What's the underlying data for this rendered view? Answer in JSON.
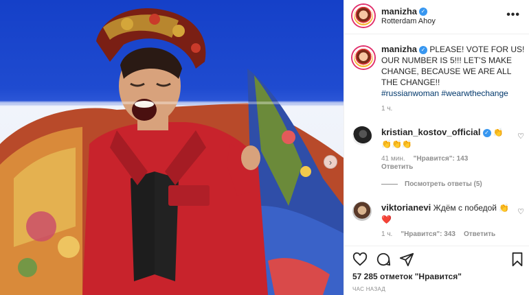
{
  "post": {
    "username": "manizha",
    "location": "Rotterdam Ahoy",
    "more_label": "•••"
  },
  "caption": {
    "username": "manizha",
    "text": "PLEASE! VOTE FOR US! OUR NUMBER IS 5!!! LET’S MAKE CHANGE, BECAUSE WE ARE ALL THE CHANGE!!",
    "hashtags": [
      "#russianwoman",
      "#wearwthechange"
    ],
    "time": "1 ч."
  },
  "comments": [
    {
      "username": "kristian_kostov_official",
      "emojis": "👏👏👏👏",
      "time": "41 мин.",
      "likes": "\"Нравится\": 143",
      "reply": "Ответить"
    },
    {
      "username": "viktorianevi",
      "text": "Ждём с победой",
      "emojis": "👏❤️",
      "time": "1 ч.",
      "likes": "\"Нравится\": 343",
      "reply": "Ответить"
    }
  ],
  "replies_toggle": "Посмотреть ответы (5)",
  "likes_text": "57 285 отметок \"Нравится\"",
  "date_text": "ЧАС НАЗАД",
  "icons": {
    "verified": "verified-badge-icon",
    "like": "heart-outline-icon",
    "comment": "comment-bubble-icon",
    "share": "paper-plane-icon",
    "save": "bookmark-icon",
    "more": "ellipsis-icon",
    "next": "chevron-right-icon"
  },
  "colors": {
    "stage_blue": "#1f4bd0",
    "outfit_red": "#c8232c",
    "verified_blue": "#3897f0",
    "hashtag_blue": "#00376b",
    "muted_text": "#8e8e8e"
  }
}
